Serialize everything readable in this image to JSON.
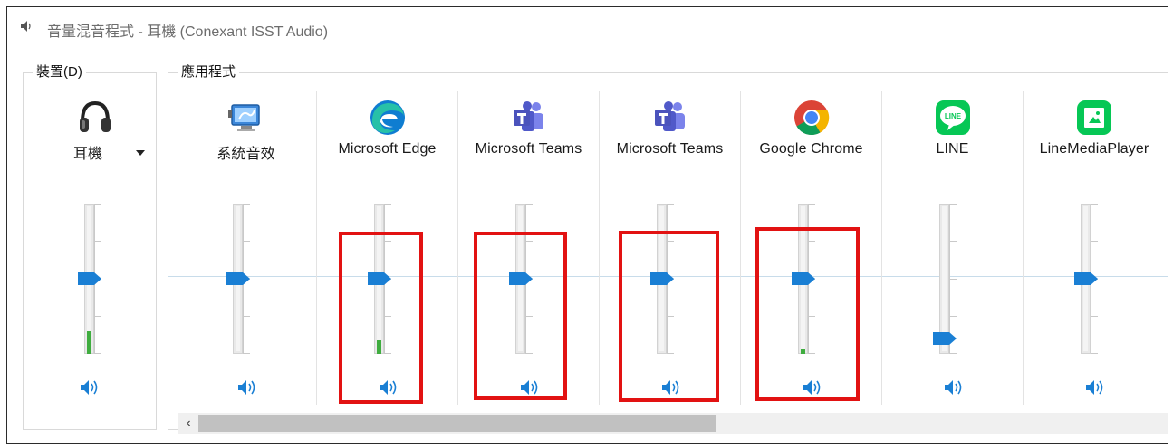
{
  "window": {
    "title": "音量混音程式 - 耳機 (Conexant ISST Audio)"
  },
  "device_group": {
    "label": "裝置(D)",
    "device": {
      "name": "耳機",
      "icon": "headphones-icon",
      "volume": 0.5,
      "meter_level": 0.15
    }
  },
  "app_group": {
    "label": "應用程式",
    "apps": [
      {
        "name": "系統音效",
        "icon": "system-sounds-icon",
        "volume": 0.5,
        "meter_level": 0,
        "highlighted": false
      },
      {
        "name": "Microsoft Edge",
        "icon": "edge-icon",
        "volume": 0.5,
        "meter_level": 0.09,
        "highlighted": true
      },
      {
        "name": "Microsoft Teams",
        "icon": "teams-icon",
        "volume": 0.5,
        "meter_level": 0,
        "highlighted": true
      },
      {
        "name": "Microsoft Teams",
        "icon": "teams-icon",
        "volume": 0.5,
        "meter_level": 0,
        "highlighted": true
      },
      {
        "name": "Google Chrome",
        "icon": "chrome-icon",
        "volume": 0.5,
        "meter_level": 0.03,
        "highlighted": true
      },
      {
        "name": "LINE",
        "icon": "line-icon",
        "volume": 0.1,
        "meter_level": 0,
        "highlighted": false
      },
      {
        "name": "LineMediaPlayer",
        "icon": "line-media-player-icon",
        "volume": 0.5,
        "meter_level": 0,
        "highlighted": false
      }
    ]
  },
  "colors": {
    "accent": "#1a7fd4",
    "meter": "#3fad3f",
    "highlight": "#e21212",
    "line_green": "#06c755"
  }
}
